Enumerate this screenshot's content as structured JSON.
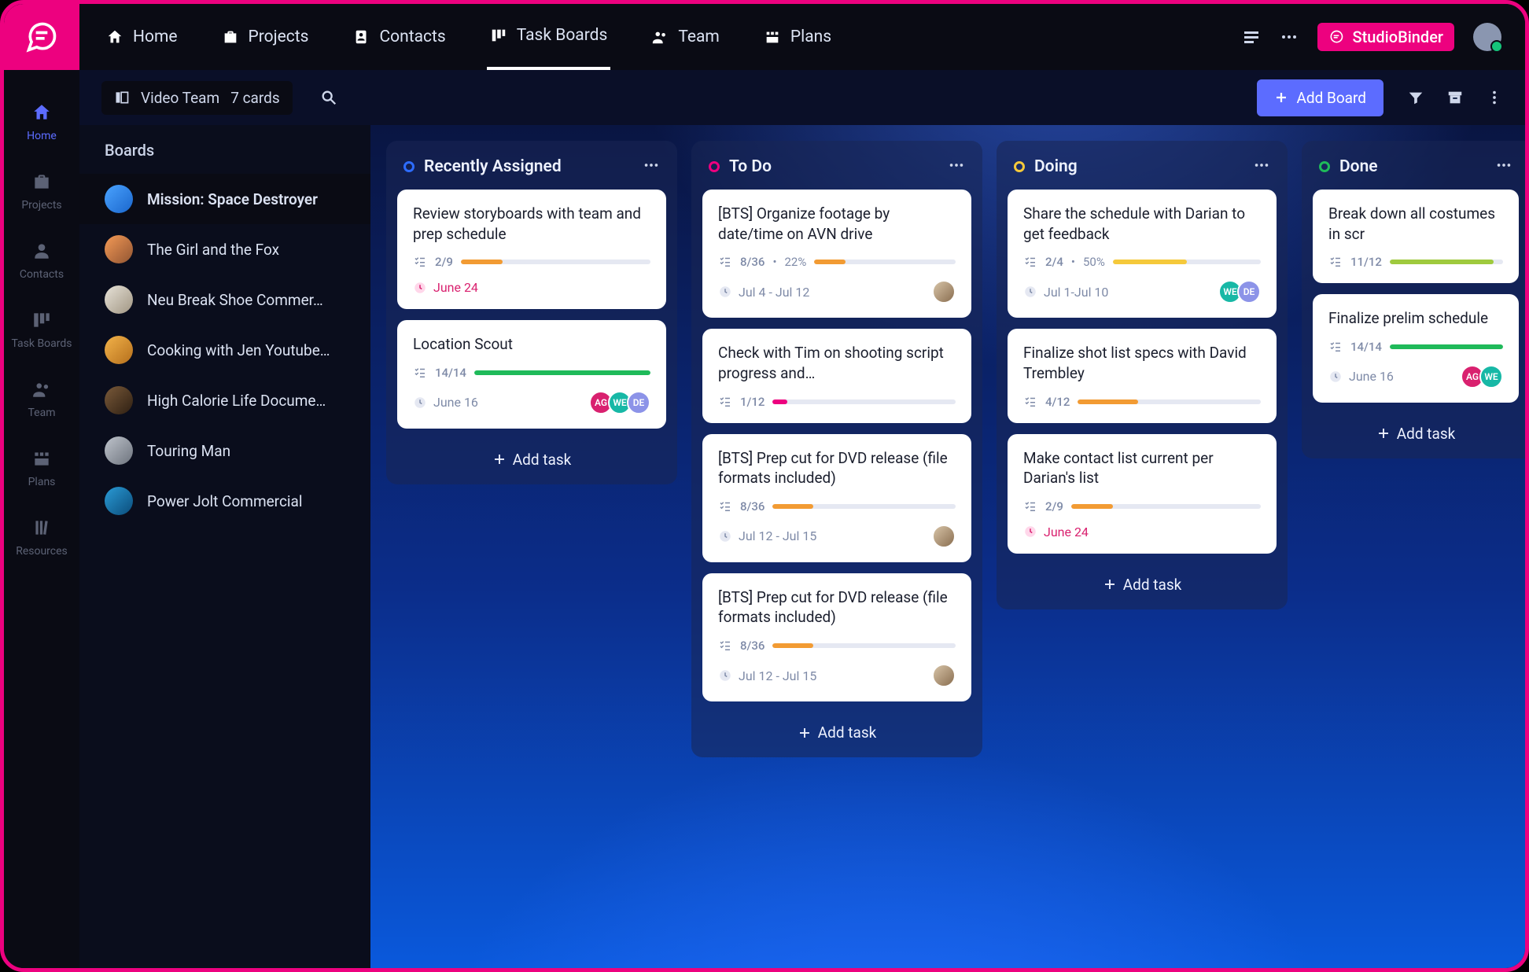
{
  "brand": {
    "name": "StudioBinder"
  },
  "navrail": {
    "items": [
      {
        "label": "Home",
        "icon": "home"
      },
      {
        "label": "Projects",
        "icon": "briefcase"
      },
      {
        "label": "Contacts",
        "icon": "user"
      },
      {
        "label": "Task Boards",
        "icon": "columns"
      },
      {
        "label": "Team",
        "icon": "people"
      },
      {
        "label": "Plans",
        "icon": "grid"
      },
      {
        "label": "Resources",
        "icon": "books"
      }
    ]
  },
  "topbar": {
    "items": [
      {
        "label": "Home",
        "icon": "home"
      },
      {
        "label": "Projects",
        "icon": "briefcase"
      },
      {
        "label": "Contacts",
        "icon": "contact"
      },
      {
        "label": "Task Boards",
        "icon": "columns"
      },
      {
        "label": "Team",
        "icon": "people"
      },
      {
        "label": "Plans",
        "icon": "grid"
      }
    ]
  },
  "subbar": {
    "board_name": "Video Team",
    "card_count": "7 cards",
    "add_board": "Add Board"
  },
  "sidebar": {
    "heading": "Boards",
    "projects": [
      {
        "name": "Mission: Space Destroyer"
      },
      {
        "name": "The Girl and the Fox"
      },
      {
        "name": "Neu Break Shoe Commer…"
      },
      {
        "name": "Cooking with Jen Youtube…"
      },
      {
        "name": "High Calorie Life Docume…"
      },
      {
        "name": "Touring Man"
      },
      {
        "name": "Power Jolt Commercial"
      }
    ]
  },
  "columns": [
    {
      "title": "Recently Assigned",
      "dot_color": "#2d6cff",
      "add_label": "Add task",
      "cards": [
        {
          "title": "Review storyboards with team and prep schedule",
          "count": "2/9",
          "pct": 22,
          "bar_color": "#f29b33",
          "extra": "",
          "date": "June 24",
          "overdue": true,
          "assignees": []
        },
        {
          "title": "Location Scout",
          "count": "14/14",
          "pct": 100,
          "bar_color": "#1fba5a",
          "extra": "",
          "date": "June 16",
          "overdue": false,
          "assignees": [
            {
              "label": "AG",
              "color": "#d9216f"
            },
            {
              "label": "WE",
              "color": "#17b8a6"
            },
            {
              "label": "DE",
              "color": "#8c93e8"
            }
          ]
        }
      ]
    },
    {
      "title": "To Do",
      "dot_color": "#ed017f",
      "add_label": "Add task",
      "cards": [
        {
          "title": "[BTS] Organize footage by date/time on AVN drive",
          "count": "8/36",
          "pct": 22,
          "bar_color": "#f29b33",
          "extra": "22%",
          "date": "Jul 4 - Jul 12",
          "overdue": false,
          "assignees": [
            {
              "label": "",
              "color": "photo"
            }
          ]
        },
        {
          "title": "Check with Tim on shooting script progress and…",
          "count": "1/12",
          "pct": 8,
          "bar_color": "#ed017f",
          "extra": "",
          "date": "",
          "overdue": false,
          "assignees": []
        },
        {
          "title": "[BTS] Prep cut for DVD release (file formats included)",
          "count": "8/36",
          "pct": 22,
          "bar_color": "#f29b33",
          "extra": "",
          "date": "Jul 12 - Jul 15",
          "overdue": false,
          "assignees": [
            {
              "label": "",
              "color": "photo"
            }
          ]
        },
        {
          "title": "[BTS] Prep cut for DVD release (file formats included)",
          "count": "8/36",
          "pct": 22,
          "bar_color": "#f29b33",
          "extra": "",
          "date": "Jul 12 - Jul 15",
          "overdue": false,
          "assignees": [
            {
              "label": "",
              "color": "photo"
            }
          ]
        }
      ]
    },
    {
      "title": "Doing",
      "dot_color": "#f5c93b",
      "add_label": "Add task",
      "cards": [
        {
          "title": "Share the schedule with Darian to get feedback",
          "count": "2/4",
          "pct": 50,
          "bar_color": "#f5c93b",
          "extra": "50%",
          "date": "Jul 1-Jul 10",
          "overdue": false,
          "assignees": [
            {
              "label": "WE",
              "color": "#17b8a6"
            },
            {
              "label": "DE",
              "color": "#8c93e8"
            }
          ]
        },
        {
          "title": "Finalize shot list specs with David Trembley",
          "count": "4/12",
          "pct": 33,
          "bar_color": "#f29b33",
          "extra": "",
          "date": "",
          "overdue": false,
          "assignees": []
        },
        {
          "title": "Make contact list current per Darian's list",
          "count": "2/9",
          "pct": 22,
          "bar_color": "#f29b33",
          "extra": "",
          "date": "June 24",
          "overdue": true,
          "assignees": []
        }
      ]
    },
    {
      "title": "Done",
      "dot_color": "#1fba5a",
      "add_label": "Add task",
      "cards": [
        {
          "title": "Break down all costumes in scr",
          "count": "11/12",
          "pct": 92,
          "bar_color": "#9fca3e",
          "extra": "",
          "date": "",
          "overdue": false,
          "assignees": []
        },
        {
          "title": "Finalize prelim schedule",
          "count": "14/14",
          "pct": 100,
          "bar_color": "#1fba5a",
          "extra": "",
          "date": "June 16",
          "overdue": false,
          "assignees": [
            {
              "label": "AG",
              "color": "#d9216f"
            },
            {
              "label": "WE",
              "color": "#17b8a6"
            }
          ]
        }
      ]
    }
  ]
}
